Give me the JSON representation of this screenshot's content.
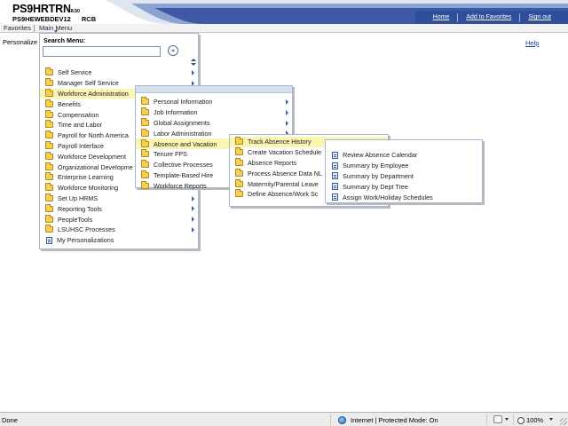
{
  "header": {
    "database": "PS9HRTRN",
    "version": "8.50",
    "server": "PS9HEWEBDEV12",
    "user": "RCB",
    "links": [
      {
        "label": "Home",
        "name": "home-link"
      },
      {
        "label": "Add to Favorites",
        "name": "add-to-favorites-link"
      },
      {
        "label": "Sign out",
        "name": "sign-out-link"
      }
    ],
    "accent_color": "#2f4f99"
  },
  "menubar": {
    "favorites_label": "Favorites",
    "main_menu_label": "Main Menu"
  },
  "page": {
    "personalize_label": "Personalize",
    "help_label": "Help"
  },
  "main_menu": {
    "search_label": "Search Menu:",
    "search_value": "",
    "go_icon": "go-arrow-icon",
    "items": [
      {
        "label": "Self Service",
        "submenu": true
      },
      {
        "label": "Manager Self Service",
        "submenu": true
      },
      {
        "label": "Workforce Administration",
        "submenu": true,
        "highlighted": true
      },
      {
        "label": "Benefits",
        "submenu": false
      },
      {
        "label": "Compensation",
        "submenu": false
      },
      {
        "label": "Time and Labor",
        "submenu": false
      },
      {
        "label": "Payroll for North America",
        "submenu": false
      },
      {
        "label": "Payroll Interface",
        "submenu": false
      },
      {
        "label": "Workforce Development",
        "submenu": false
      },
      {
        "label": "Organizational Developme",
        "submenu": false
      },
      {
        "label": "Enterprise Learning",
        "submenu": false
      },
      {
        "label": "Workforce Monitoring",
        "submenu": false
      },
      {
        "label": "Set Up HRMS",
        "submenu": true
      },
      {
        "label": "Reporting Tools",
        "submenu": true
      },
      {
        "label": "PeopleTools",
        "submenu": true
      },
      {
        "label": "LSUHSC Processes",
        "submenu": true
      },
      {
        "label": "My Personalizations",
        "submenu": false,
        "page": true
      }
    ]
  },
  "workforce_menu": {
    "items": [
      {
        "label": "Personal Information",
        "submenu": true
      },
      {
        "label": "Job Information",
        "submenu": true
      },
      {
        "label": "Global Assignments",
        "submenu": true
      },
      {
        "label": "Labor Administration",
        "submenu": true
      },
      {
        "label": "Absence and Vacation",
        "submenu": true,
        "highlighted": true
      },
      {
        "label": "Tenure FPS",
        "submenu": false
      },
      {
        "label": "Collective Processes",
        "submenu": false
      },
      {
        "label": "Template-Based Hire",
        "submenu": false
      },
      {
        "label": "Workforce Reports",
        "submenu": false
      }
    ]
  },
  "absence_menu": {
    "items": [
      {
        "label": "Track Absence History",
        "highlighted": true
      },
      {
        "label": "Create Vacation Schedule"
      },
      {
        "label": "Absence Reports"
      },
      {
        "label": "Process Absence Data NL"
      },
      {
        "label": "Maternity/Parental Leave"
      },
      {
        "label": "Define Absence/Work Sc"
      }
    ]
  },
  "track_menu": {
    "items": [
      {
        "label": "Review Absence Calendar"
      },
      {
        "label": "Summary by Employee"
      },
      {
        "label": "Summary by Department"
      },
      {
        "label": "Summary by Dept Tree"
      },
      {
        "label": "Assign Work/Holiday Schedules"
      }
    ]
  },
  "statusbar": {
    "status": "Done",
    "zone": "Internet | Protected Mode: On",
    "zoom": "100%"
  }
}
